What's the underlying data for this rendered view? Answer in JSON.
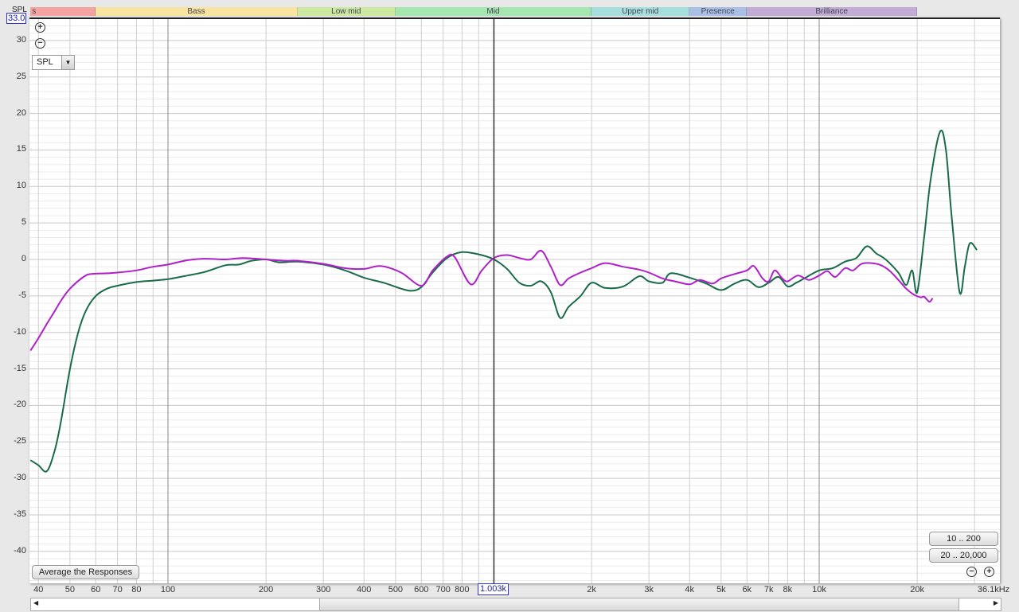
{
  "bands": [
    {
      "label": "s",
      "from": 37.8,
      "to": 60,
      "color": "#f4a3a3"
    },
    {
      "label": "Bass",
      "from": 60,
      "to": 250,
      "color": "#f8e3a0"
    },
    {
      "label": "Low mid",
      "from": 250,
      "to": 500,
      "color": "#cde8a0"
    },
    {
      "label": "Mid",
      "from": 500,
      "to": 2000,
      "color": "#a6e6b0"
    },
    {
      "label": "Upper mid",
      "from": 2000,
      "to": 4000,
      "color": "#a6dede"
    },
    {
      "label": "Presence",
      "from": 4000,
      "to": 6000,
      "color": "#aabfe6"
    },
    {
      "label": "Brilliance",
      "from": 6000,
      "to": 20000,
      "color": "#c2acd6"
    }
  ],
  "controls": {
    "zoom_in_icon": "plus-circle-icon",
    "zoom_out_icon": "minus-circle-icon",
    "measure_select": "SPL",
    "average_button": "Average the Responses",
    "range_button_1": "10 .. 200",
    "range_button_2": "20 .. 20,000"
  },
  "cursor": {
    "y_readout": "33.0",
    "x_readout": "1.003k",
    "frequency": 1003
  },
  "chart_data": {
    "type": "line",
    "ylabel": "SPL",
    "xscale": "log",
    "xlim": [
      37.8,
      36100
    ],
    "ylim": [
      -44,
      33
    ],
    "grid": true,
    "ytick_labels": [
      "30",
      "25",
      "20",
      "15",
      "10",
      "5",
      "0",
      "-5",
      "-10",
      "-15",
      "-20",
      "-25",
      "-30",
      "-35",
      "-40"
    ],
    "xtick_labels": [
      {
        "f": 40,
        "t": "40"
      },
      {
        "f": 50,
        "t": "50"
      },
      {
        "f": 60,
        "t": "60"
      },
      {
        "f": 70,
        "t": "70"
      },
      {
        "f": 80,
        "t": "80"
      },
      {
        "f": 100,
        "t": "100"
      },
      {
        "f": 200,
        "t": "200"
      },
      {
        "f": 300,
        "t": "300"
      },
      {
        "f": 400,
        "t": "400"
      },
      {
        "f": 500,
        "t": "500"
      },
      {
        "f": 600,
        "t": "600"
      },
      {
        "f": 700,
        "t": "700"
      },
      {
        "f": 800,
        "t": "800"
      },
      {
        "f": 2000,
        "t": "2k"
      },
      {
        "f": 3000,
        "t": "3k"
      },
      {
        "f": 4000,
        "t": "4k"
      },
      {
        "f": 5000,
        "t": "5k"
      },
      {
        "f": 6000,
        "t": "6k"
      },
      {
        "f": 7000,
        "t": "7k"
      },
      {
        "f": 8000,
        "t": "8k"
      },
      {
        "f": 10000,
        "t": "10k"
      },
      {
        "f": 20000,
        "t": "20k"
      },
      {
        "f": 36100,
        "t": "36.1kHz"
      }
    ],
    "series": [
      {
        "color": "#1a6b4a",
        "points": [
          [
            37.8,
            -27.5
          ],
          [
            40,
            -28.2
          ],
          [
            42.5,
            -29
          ],
          [
            45,
            -26
          ],
          [
            47,
            -22
          ],
          [
            50,
            -15
          ],
          [
            53,
            -10
          ],
          [
            56,
            -7
          ],
          [
            60,
            -5
          ],
          [
            65,
            -4
          ],
          [
            70,
            -3.6
          ],
          [
            80,
            -3.1
          ],
          [
            90,
            -2.9
          ],
          [
            100,
            -2.7
          ],
          [
            115,
            -2.2
          ],
          [
            130,
            -1.7
          ],
          [
            150,
            -0.8
          ],
          [
            165,
            -0.7
          ],
          [
            180,
            -0.2
          ],
          [
            200,
            0
          ],
          [
            220,
            -0.4
          ],
          [
            250,
            -0.3
          ],
          [
            300,
            -0.7
          ],
          [
            350,
            -1.5
          ],
          [
            400,
            -2.5
          ],
          [
            460,
            -3.2
          ],
          [
            520,
            -4
          ],
          [
            560,
            -4.3
          ],
          [
            600,
            -3.8
          ],
          [
            650,
            -1.8
          ],
          [
            720,
            0.2
          ],
          [
            800,
            1
          ],
          [
            900,
            0.7
          ],
          [
            1003,
            0
          ],
          [
            1100,
            -1.3
          ],
          [
            1200,
            -3.2
          ],
          [
            1300,
            -3.6
          ],
          [
            1400,
            -3
          ],
          [
            1500,
            -4.5
          ],
          [
            1600,
            -8
          ],
          [
            1700,
            -6.5
          ],
          [
            1850,
            -5
          ],
          [
            2000,
            -3.2
          ],
          [
            2200,
            -3.9
          ],
          [
            2500,
            -3.7
          ],
          [
            2800,
            -2.3
          ],
          [
            3000,
            -3
          ],
          [
            3300,
            -3.2
          ],
          [
            3500,
            -1.9
          ],
          [
            4000,
            -2.5
          ],
          [
            4500,
            -3.3
          ],
          [
            5000,
            -4.2
          ],
          [
            5500,
            -3.3
          ],
          [
            6000,
            -2.8
          ],
          [
            6500,
            -3.8
          ],
          [
            7000,
            -3.2
          ],
          [
            7500,
            -2.4
          ],
          [
            8000,
            -3.7
          ],
          [
            8500,
            -3.2
          ],
          [
            9000,
            -2.6
          ],
          [
            10000,
            -1.5
          ],
          [
            11000,
            -1.2
          ],
          [
            12000,
            -0.3
          ],
          [
            13000,
            0.2
          ],
          [
            14000,
            1.8
          ],
          [
            15000,
            0.8
          ],
          [
            16000,
            0
          ],
          [
            17500,
            -1.8
          ],
          [
            18500,
            -3.5
          ],
          [
            19300,
            -1.5
          ],
          [
            20000,
            -4.5
          ],
          [
            21000,
            3
          ],
          [
            22000,
            11
          ],
          [
            23500,
            17.5
          ],
          [
            24500,
            15
          ],
          [
            25500,
            6
          ],
          [
            27000,
            -4.5
          ],
          [
            28000,
            -1
          ],
          [
            29000,
            2.2
          ],
          [
            30500,
            1.3
          ]
        ]
      },
      {
        "color": "#b020c8",
        "points": [
          [
            37.8,
            -12.5
          ],
          [
            40,
            -10.8
          ],
          [
            42.5,
            -8.8
          ],
          [
            45,
            -7
          ],
          [
            47,
            -5.6
          ],
          [
            50,
            -4
          ],
          [
            55,
            -2.4
          ],
          [
            58,
            -2
          ],
          [
            65,
            -1.9
          ],
          [
            70,
            -1.8
          ],
          [
            80,
            -1.5
          ],
          [
            90,
            -1
          ],
          [
            100,
            -0.7
          ],
          [
            115,
            -0.1
          ],
          [
            130,
            0.1
          ],
          [
            150,
            0
          ],
          [
            170,
            0.2
          ],
          [
            200,
            0
          ],
          [
            230,
            -0.2
          ],
          [
            250,
            -0.2
          ],
          [
            300,
            -0.6
          ],
          [
            350,
            -1.2
          ],
          [
            400,
            -1.3
          ],
          [
            450,
            -0.9
          ],
          [
            520,
            -1.8
          ],
          [
            600,
            -3.6
          ],
          [
            650,
            -1.5
          ],
          [
            720,
            0.4
          ],
          [
            760,
            0.3
          ],
          [
            850,
            -3.4
          ],
          [
            920,
            -1.5
          ],
          [
            1003,
            0.2
          ],
          [
            1100,
            0.6
          ],
          [
            1200,
            0.2
          ],
          [
            1300,
            0
          ],
          [
            1400,
            1.2
          ],
          [
            1500,
            -1
          ],
          [
            1600,
            -3.5
          ],
          [
            1700,
            -2.6
          ],
          [
            1850,
            -1.8
          ],
          [
            2000,
            -1.2
          ],
          [
            2200,
            -0.5
          ],
          [
            2500,
            -1
          ],
          [
            2800,
            -1.4
          ],
          [
            3000,
            -1.8
          ],
          [
            3300,
            -2.6
          ],
          [
            3600,
            -3
          ],
          [
            4000,
            -3.4
          ],
          [
            4300,
            -2.8
          ],
          [
            4700,
            -3.3
          ],
          [
            5000,
            -2.6
          ],
          [
            5500,
            -2
          ],
          [
            6000,
            -1.5
          ],
          [
            6300,
            -0.9
          ],
          [
            6700,
            -2.6
          ],
          [
            7000,
            -3
          ],
          [
            7300,
            -1.5
          ],
          [
            7700,
            -2.6
          ],
          [
            8000,
            -3
          ],
          [
            8600,
            -2.2
          ],
          [
            9300,
            -2.8
          ],
          [
            10000,
            -2.2
          ],
          [
            10600,
            -1.6
          ],
          [
            11200,
            -2.4
          ],
          [
            12000,
            -1.2
          ],
          [
            12700,
            -1.5
          ],
          [
            13500,
            -0.6
          ],
          [
            14500,
            -0.5
          ],
          [
            15500,
            -0.8
          ],
          [
            16500,
            -1.6
          ],
          [
            17500,
            -2.8
          ],
          [
            18500,
            -4
          ],
          [
            19500,
            -4.8
          ],
          [
            20500,
            -5.2
          ],
          [
            21000,
            -5.1
          ],
          [
            21800,
            -5.8
          ],
          [
            22300,
            -5.3
          ]
        ]
      }
    ]
  }
}
